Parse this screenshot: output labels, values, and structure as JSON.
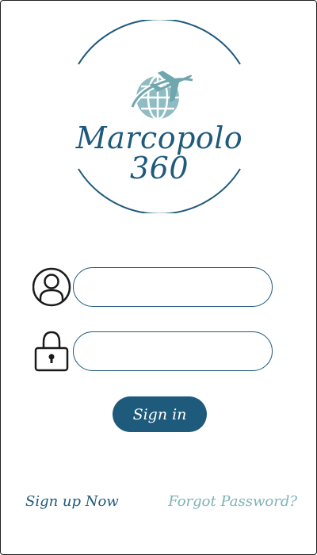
{
  "brand": {
    "name": "Marcopolo 360"
  },
  "icons": {
    "logo": "globe-airplane-icon",
    "user": "user-icon",
    "password": "lock-icon"
  },
  "form": {
    "username": {
      "value": "",
      "placeholder": ""
    },
    "password": {
      "value": "",
      "placeholder": ""
    },
    "submit_label": "Sign in"
  },
  "footer": {
    "signup_label": "Sign up Now",
    "forgot_label": "Forgot Password?"
  },
  "colors": {
    "primary": "#1e5a7c",
    "accent": "#7fb2b8",
    "icon": "#1a1a1a",
    "background": "#ffffff"
  }
}
